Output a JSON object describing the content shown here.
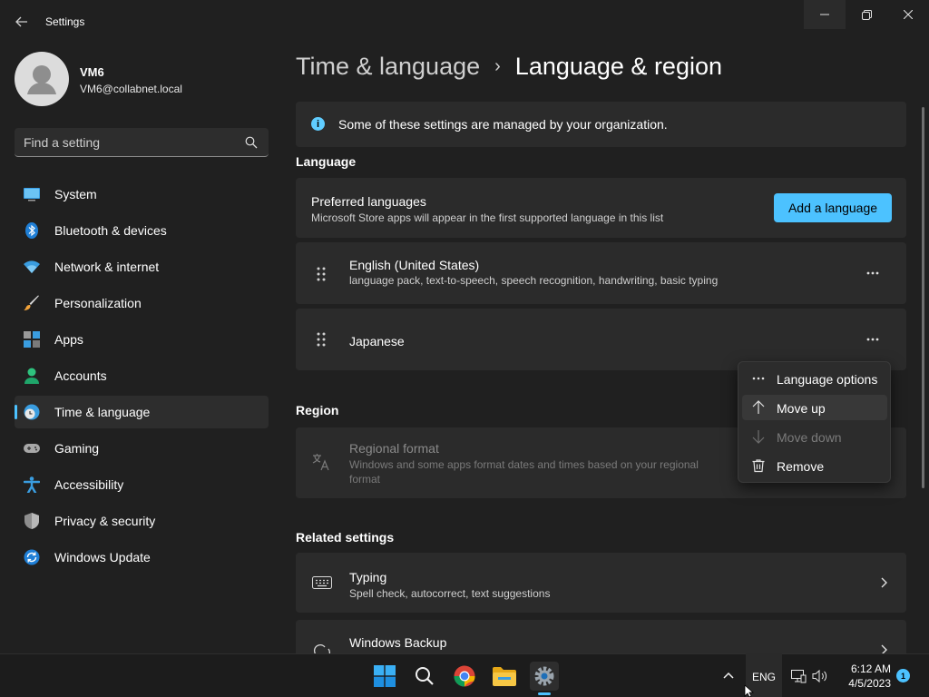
{
  "window": {
    "title": "Settings"
  },
  "profile": {
    "name": "VM6",
    "email": "VM6@collabnet.local"
  },
  "search": {
    "placeholder": "Find a setting"
  },
  "sidebar": {
    "items": [
      {
        "label": "System",
        "icon": "monitor-icon",
        "active": false
      },
      {
        "label": "Bluetooth & devices",
        "icon": "bluetooth-icon",
        "active": false
      },
      {
        "label": "Network & internet",
        "icon": "wifi-icon",
        "active": false
      },
      {
        "label": "Personalization",
        "icon": "paintbrush-icon",
        "active": false
      },
      {
        "label": "Apps",
        "icon": "apps-icon",
        "active": false
      },
      {
        "label": "Accounts",
        "icon": "person-icon",
        "active": false
      },
      {
        "label": "Time & language",
        "icon": "globe-clock-icon",
        "active": true
      },
      {
        "label": "Gaming",
        "icon": "gamepad-icon",
        "active": false
      },
      {
        "label": "Accessibility",
        "icon": "accessibility-icon",
        "active": false
      },
      {
        "label": "Privacy & security",
        "icon": "shield-icon",
        "active": false
      },
      {
        "label": "Windows Update",
        "icon": "update-icon",
        "active": false
      }
    ]
  },
  "breadcrumb": {
    "parent": "Time & language",
    "separator": "›",
    "current": "Language & region"
  },
  "info": {
    "text": "Some of these settings are managed by your organization.",
    "icon_glyph": "i"
  },
  "language": {
    "heading": "Language",
    "preferred_title": "Preferred languages",
    "preferred_sub": "Microsoft Store apps will appear in the first supported language in this list",
    "add_label": "Add a language",
    "languages": [
      {
        "name": "English (United States)",
        "features": "language pack, text-to-speech, speech recognition, handwriting, basic typing"
      },
      {
        "name": "Japanese",
        "features": ""
      }
    ]
  },
  "context_menu": {
    "items": [
      {
        "label": "Language options",
        "icon": "more-horizontal-icon",
        "disabled": false
      },
      {
        "label": "Move up",
        "icon": "arrow-up-icon",
        "disabled": false
      },
      {
        "label": "Move down",
        "icon": "arrow-down-icon",
        "disabled": true
      },
      {
        "label": "Remove",
        "icon": "trash-icon",
        "disabled": false
      }
    ]
  },
  "region": {
    "heading": "Region",
    "format_title": "Regional format",
    "format_sub": "Windows and some apps format dates and times based on your regional format"
  },
  "related": {
    "heading": "Related settings",
    "typing_title": "Typing",
    "typing_sub": "Spell check, autocorrect, text suggestions",
    "backup_title": "Windows Backup"
  },
  "taskbar": {
    "input_language": "ENG",
    "time": "6:12 AM",
    "date": "4/5/2023",
    "notification_count": "1"
  },
  "colors": {
    "accent": "#4cc2ff",
    "background": "#202020",
    "card": "#2b2b2b"
  }
}
